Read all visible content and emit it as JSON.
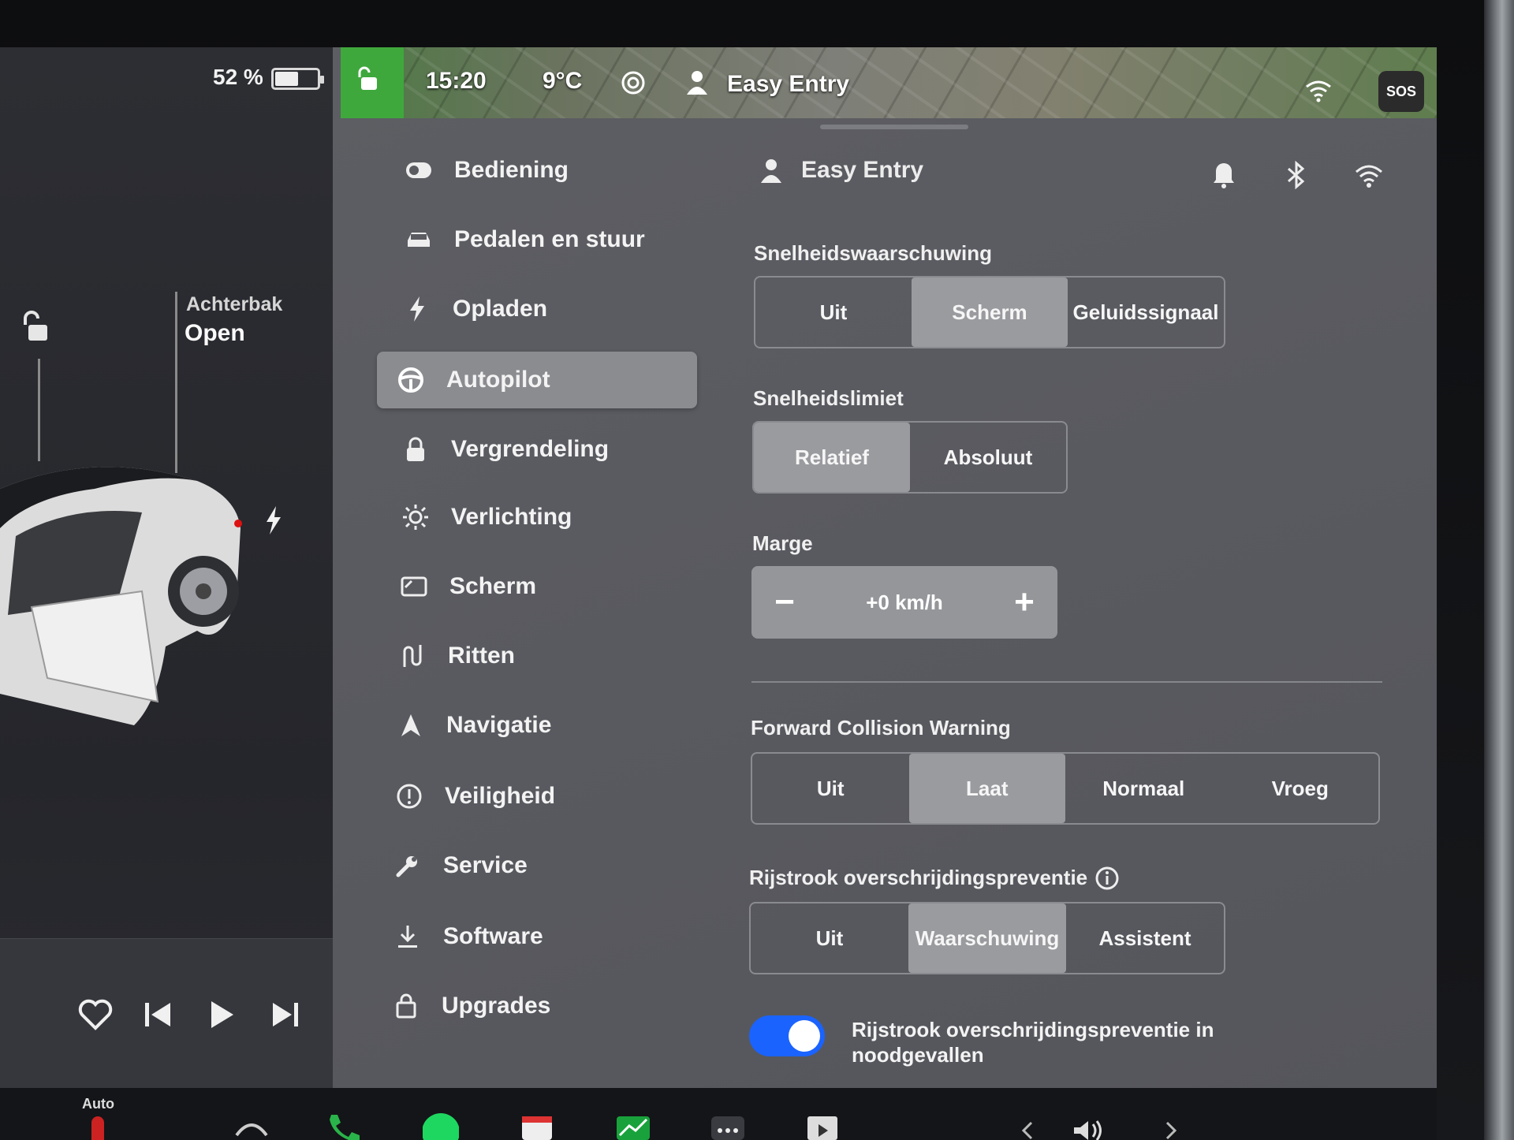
{
  "status": {
    "battery_percent": "52 %",
    "battery_level": 0.52,
    "time": "15:20",
    "temperature": "9°C",
    "profile_name": "Easy Entry",
    "sos": "SOS"
  },
  "car": {
    "trunk_label": "Achterbak",
    "trunk_status": "Open"
  },
  "menu": {
    "items": [
      {
        "label": "Bediening",
        "icon": "toggle-icon"
      },
      {
        "label": "Pedalen en stuur",
        "icon": "car-icon"
      },
      {
        "label": "Opladen",
        "icon": "bolt-icon"
      },
      {
        "label": "Autopilot",
        "icon": "steering-wheel-icon",
        "active": true
      },
      {
        "label": "Vergrendeling",
        "icon": "lock-icon"
      },
      {
        "label": "Verlichting",
        "icon": "light-icon"
      },
      {
        "label": "Scherm",
        "icon": "display-icon"
      },
      {
        "label": "Ritten",
        "icon": "trips-icon"
      },
      {
        "label": "Navigatie",
        "icon": "navigation-icon"
      },
      {
        "label": "Veiligheid",
        "icon": "alert-icon"
      },
      {
        "label": "Service",
        "icon": "wrench-icon"
      },
      {
        "label": "Software",
        "icon": "download-icon"
      },
      {
        "label": "Upgrades",
        "icon": "bag-icon"
      }
    ]
  },
  "content": {
    "profile": "Easy Entry",
    "speed_warning": {
      "label": "Snelheidswaarschuwing",
      "options": [
        "Uit",
        "Scherm",
        "Geluidssignaal"
      ],
      "selected": "Scherm"
    },
    "speed_limit": {
      "label": "Snelheidslimiet",
      "options": [
        "Relatief",
        "Absoluut"
      ],
      "selected": "Relatief"
    },
    "margin": {
      "label": "Marge",
      "value": "+0 km/h",
      "minus": "−",
      "plus": "+"
    },
    "forward_collision": {
      "label": "Forward Collision Warning",
      "options": [
        "Uit",
        "Laat",
        "Normaal",
        "Vroeg"
      ],
      "selected": "Laat"
    },
    "lane_departure": {
      "label": "Rijstrook overschrijdingspreventie",
      "options": [
        "Uit",
        "Waarschuwing",
        "Assistent"
      ],
      "selected": "Waarschuwing"
    },
    "emergency_lane": {
      "label": "Rijstrook overschrijdingspreventie in noodgevallen",
      "enabled": true
    }
  },
  "dock": {
    "seat_heat_label": "Auto"
  },
  "colors": {
    "toggle_on": "#1a63ff",
    "map_green": "#3fa83c"
  }
}
